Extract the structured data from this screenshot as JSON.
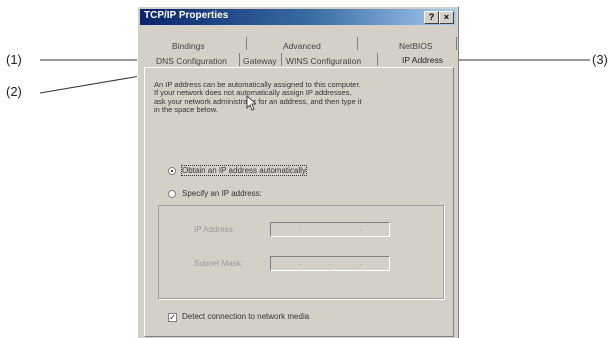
{
  "window": {
    "title": "TCP/IP Properties",
    "help_glyph": "?",
    "close_glyph": "×"
  },
  "tabs_row1": [
    "Bindings",
    "Advanced",
    "NetBIOS"
  ],
  "tabs_row2": [
    "DNS Configuration",
    "Gateway",
    "WINS Configuration",
    "IP Address"
  ],
  "callouts": [
    "(1)",
    "(2)",
    "(3)"
  ],
  "description": "An IP address can be automatically assigned to this computer. If your network does not automatically assign IP addresses, ask your network administrator for an address, and then type it in the space below.",
  "options": {
    "obtain": {
      "label": "Obtain an IP address automatically",
      "selected": true
    },
    "specify": {
      "label": "Specify an IP address:",
      "selected": false
    }
  },
  "fields": {
    "ip_label": "IP Address:",
    "subnet_label": "Subnet Mask:",
    "ip_dots": ".",
    "subnet_dots": "."
  },
  "detect": {
    "label": "Detect connection to network media",
    "checked": true,
    "check_glyph": "✓"
  }
}
